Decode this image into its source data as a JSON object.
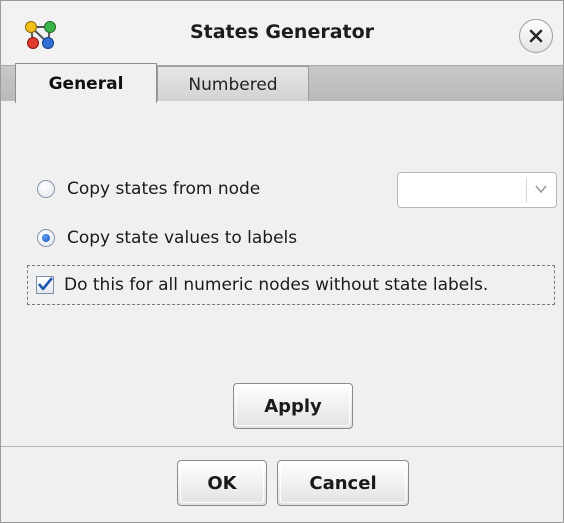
{
  "window": {
    "title": "States Generator",
    "app_icon": "network-nodes-icon",
    "close_icon": "close-icon"
  },
  "tabs": [
    {
      "label": "General",
      "selected": true
    },
    {
      "label": "Numbered",
      "selected": false
    }
  ],
  "general": {
    "copy_states_from_node": {
      "label": "Copy states from node",
      "selected": false
    },
    "node_select": {
      "value": "",
      "icon": "chevron-down-icon"
    },
    "copy_state_values": {
      "label": "Copy state values to labels",
      "selected": true
    },
    "all_numeric_nodes": {
      "label": "Do this for all numeric nodes without state labels.",
      "checked": true
    },
    "apply_label": "Apply"
  },
  "footer": {
    "ok_label": "OK",
    "cancel_label": "Cancel"
  },
  "colors": {
    "window_bg": "#f0f0f0",
    "tabstrip_bg": "#c0c0c0",
    "radio_selected": "#1a5cc8",
    "checkmark": "#1b56b0"
  }
}
